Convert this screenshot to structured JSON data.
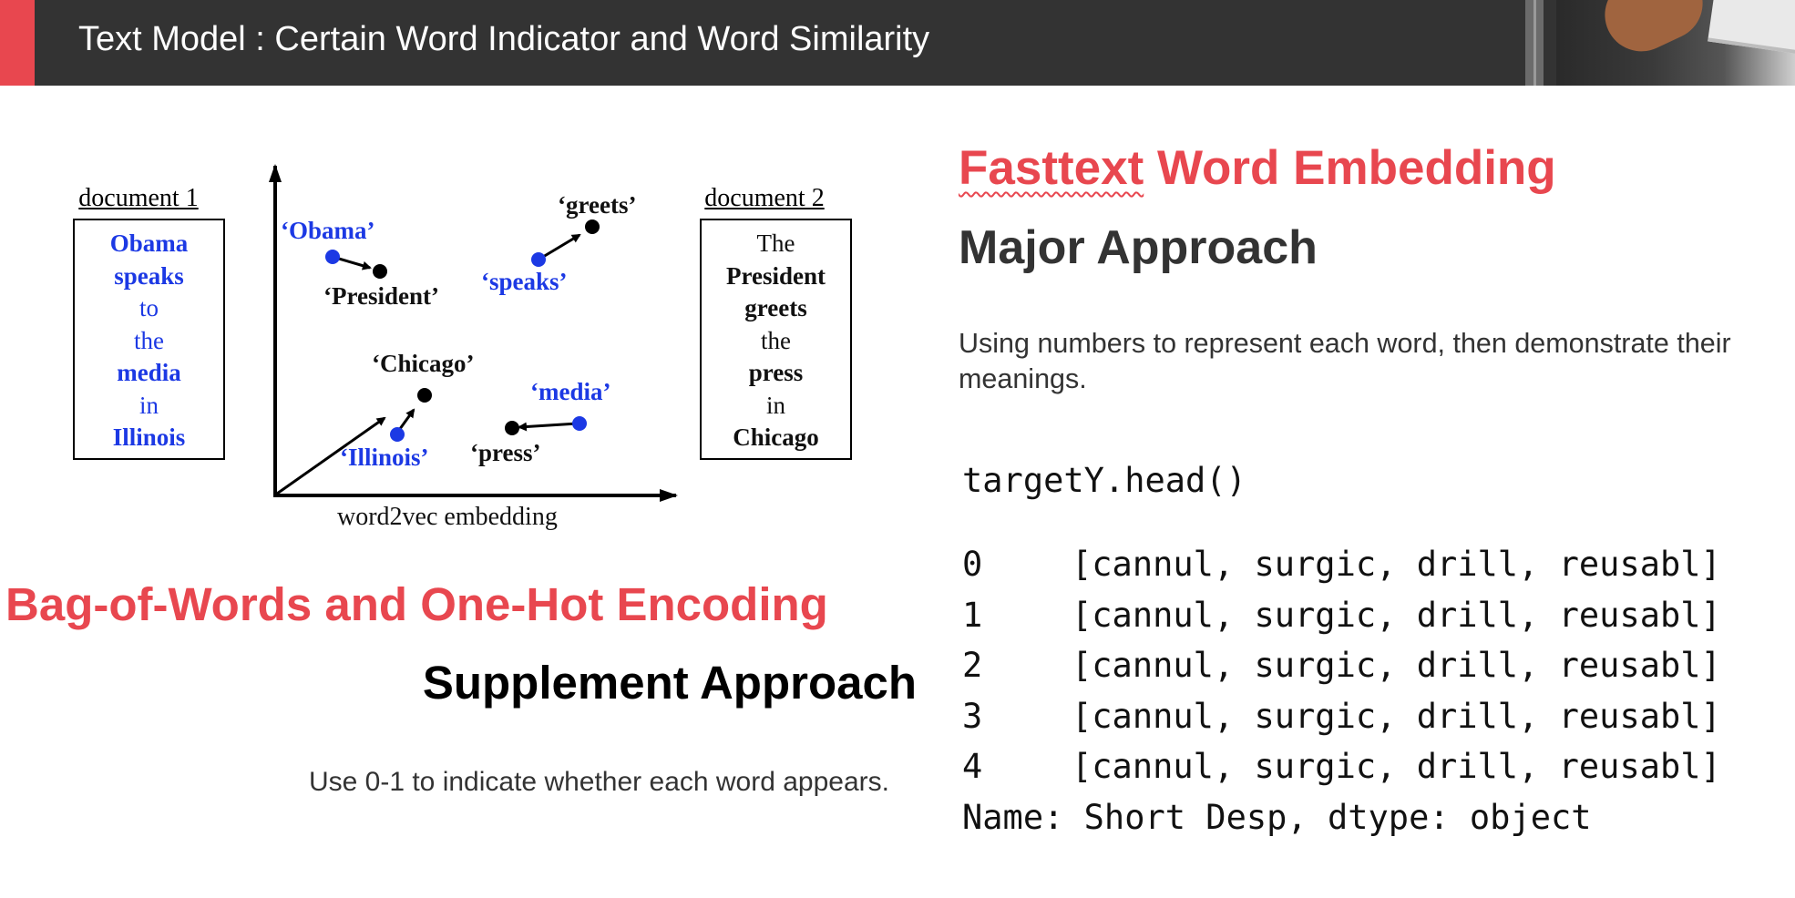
{
  "header": {
    "title": "Text Model : Certain Word Indicator and Word Similarity",
    "accent_color": "#e8474f",
    "bar_color": "#333333"
  },
  "figure": {
    "document1": {
      "title": "document 1",
      "words": [
        "Obama",
        "speaks",
        "to",
        "the",
        "media",
        "in",
        "Illinois"
      ]
    },
    "document2": {
      "title": "document 2",
      "words": [
        "The",
        "President",
        "greets",
        "the",
        "press",
        "in",
        "Chicago"
      ]
    },
    "axis_label": "word2vec embedding",
    "points": {
      "obama": "‘Obama’",
      "president": "‘President’",
      "greets": "‘greets’",
      "speaks": "‘speaks’",
      "chicago": "‘Chicago’",
      "illinois": "‘Illinois’",
      "media": "‘media’",
      "press": "‘press’"
    },
    "blue_color": "#1c39e4"
  },
  "left": {
    "bow_title": "Bag-of-Words and One-Hot Encoding",
    "supplement_title": "Supplement Approach",
    "supplement_desc": "Use 0-1 to indicate whether each word appears."
  },
  "right": {
    "fasttext_word": "Fasttext",
    "fasttext_rest": " Word Embedding",
    "major_title": "Major Approach",
    "major_desc": "Using numbers to represent each word, then demonstrate their meanings.",
    "code": {
      "command": "targetY.head()",
      "rows": [
        {
          "index": "0",
          "value": "[cannul, surgic, drill, reusabl]"
        },
        {
          "index": "1",
          "value": "[cannul, surgic, drill, reusabl]"
        },
        {
          "index": "2",
          "value": "[cannul, surgic, drill, reusabl]"
        },
        {
          "index": "3",
          "value": "[cannul, surgic, drill, reusabl]"
        },
        {
          "index": "4",
          "value": "[cannul, surgic, drill, reusabl]"
        }
      ],
      "footer": "Name: Short Desp, dtype: object"
    }
  }
}
